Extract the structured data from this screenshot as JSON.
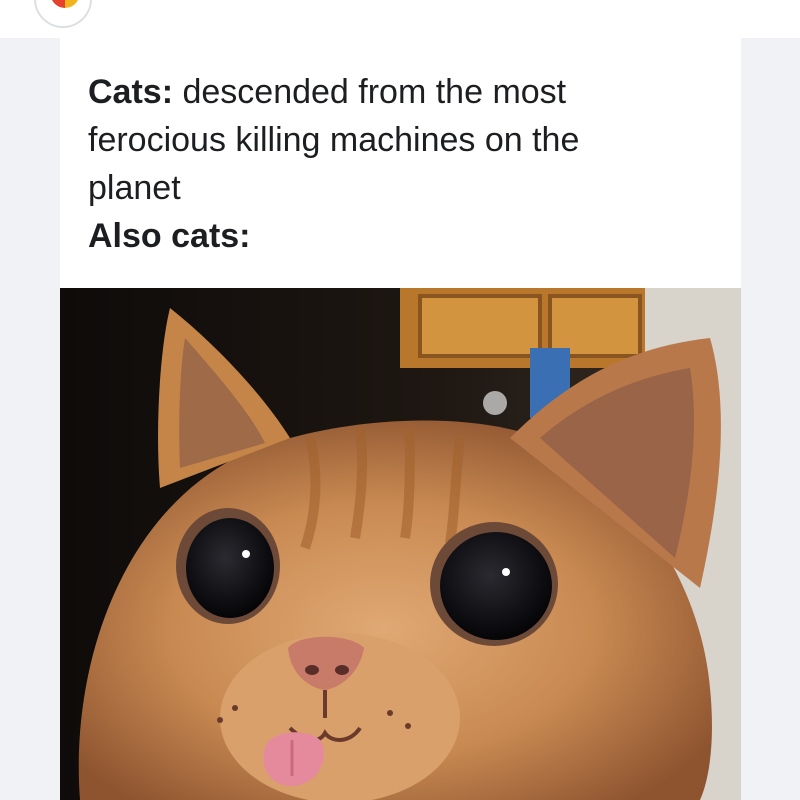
{
  "post": {
    "caption": {
      "line1_bold": "Cats:",
      "line1_rest": " descended from the most",
      "line2": "ferocious killing machines on the",
      "line3": "planet",
      "line4_bold": "Also cats:"
    },
    "image": {
      "subject": "orange-tabby-cat-wide-eyes-tongue-out-icon",
      "colors": {
        "fur": "#c98a52",
        "fur_dark": "#9a5e32",
        "background_dark": "#141010",
        "cabinet": "#c9882e",
        "tongue": "#e58a9c"
      }
    }
  }
}
